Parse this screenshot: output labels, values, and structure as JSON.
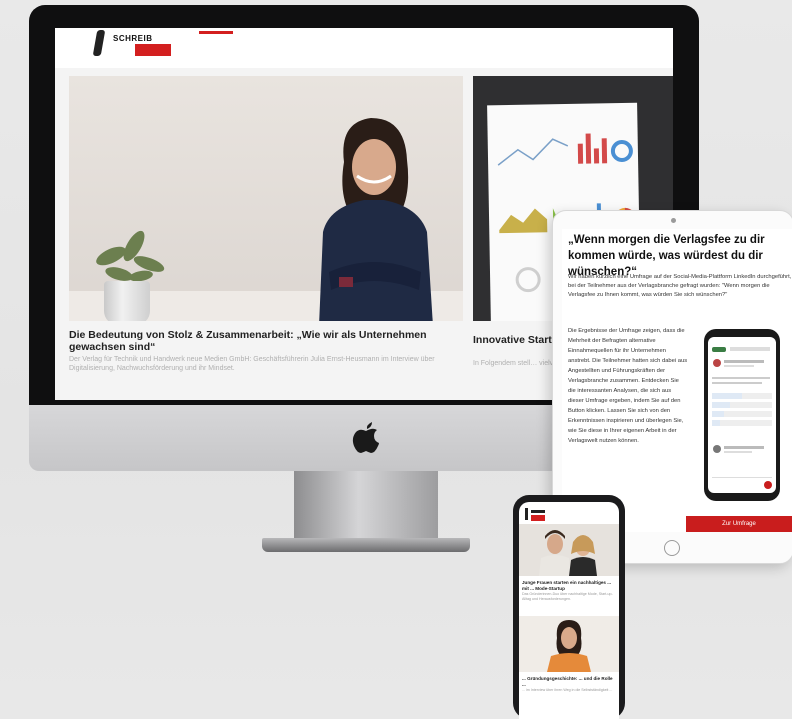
{
  "desktop": {
    "logo_text": "SCHREIB",
    "article_main": {
      "title": "Die Bedeutung von Stolz & Zusammenarbeit: „Wie wir als Unternehmen gewachsen sind“",
      "teaser": "Der Verlag für Technik und Handwerk neue Medien GmbH: Geschäftsführerin Julia Ernst-Heusmann im Interview über Digitalisierung, Nachwuchsförderung und ihr Mindset."
    },
    "article_side": {
      "title": "Innovative Start… die Verlagsbra…",
      "teaser": "In Folgendem stell… vielversprechende…"
    }
  },
  "tablet": {
    "title": "„Wenn morgen die Verlagsfee zu dir kommen würde, was würdest du dir wünschen?“",
    "intro": "Wir haben kürzlich eine Umfrage auf der Social-Media-Plattform LinkedIn durchgeführt, bei der Teilnehmer aus der Verlagsbranche gefragt wurden: \"Wenn morgen die Verlagsfee zu Ihnen kommt, was würden Sie sich wünschen?\"",
    "body": "Die Ergebnisse der Umfrage zeigen, dass die Mehrheit der Befragten alternative Einnahmequellen für ihr Unternehmen anstrebt. Die Teilnehmer hatten sich dabei aus Angestellten und Führungskräften der Verlagsbranche zusammen. Entdecken Sie die interessanten Analysen, die sich aus dieser Umfrage ergeben, indem Sie auf den Button klicken. Lassen Sie sich von den Erkenntnissen inspirieren und überlegen Sie, wie Sie diese in Ihrer eigenen Arbeit in der Verlagswelt nutzen können.",
    "cta": "Zur Umfrage"
  },
  "phone": {
    "article1": {
      "title": "Junge Frauen starten ein nachhaltiges ... mit ... Mode-Startup",
      "teaser": "Das Gründerinnen-Duo über nachhaltige Mode, Start-up-Alltag und Herausforderungen."
    },
    "article2": {
      "title": "... Gründungsgeschichte: ... und die Rolle ...",
      "teaser": "... im Interview über ihren Weg in die Selbstständigkeit ..."
    }
  },
  "colors": {
    "brand_red": "#d31f1f",
    "cta_red": "#c91d1d",
    "bezel": "#0f0f10"
  }
}
